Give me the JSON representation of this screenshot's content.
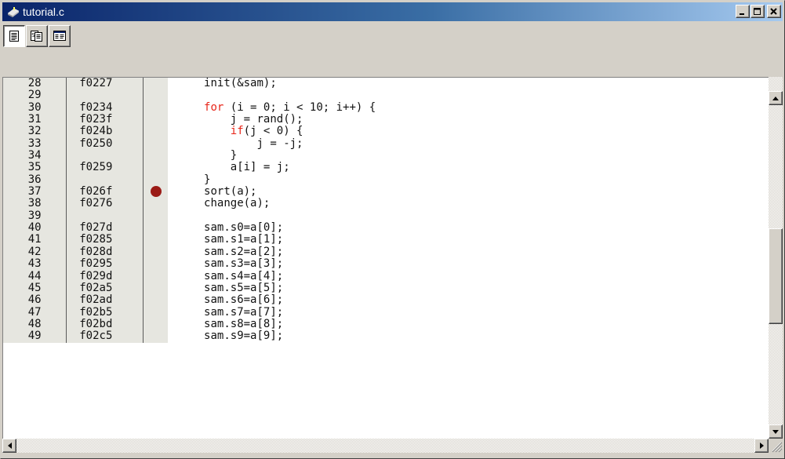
{
  "window": {
    "title": "tutorial.c",
    "title_icon": "application-icon",
    "controls": [
      "minimize-icon",
      "maximize-icon",
      "close-icon"
    ]
  },
  "toolbar": {
    "buttons": [
      {
        "icon": "source-view-icon",
        "pressed": true
      },
      {
        "icon": "mixed-view-icon",
        "pressed": false
      },
      {
        "icon": "disassembly-view-icon",
        "pressed": false
      }
    ]
  },
  "colors": {
    "keyword": "#e8261a",
    "breakpoint": "#9b1b16",
    "gutter": "#e6e6e0",
    "title_gradient_start": "#0a246a",
    "title_gradient_end": "#a6caf0"
  },
  "code": {
    "lines": [
      {
        "line": "28",
        "address": "f0227",
        "text": "init(&sam);",
        "indent": 0
      },
      {
        "line": "29",
        "address": "",
        "text": "",
        "indent": 0
      },
      {
        "line": "30",
        "address": "f0234",
        "kw": "for",
        "text": " (i = 0; i < 10; i++) {",
        "indent": 0
      },
      {
        "line": "31",
        "address": "f023f",
        "text": "j = rand();",
        "indent": 4
      },
      {
        "line": "32",
        "address": "f024b",
        "kw": "if",
        "text": "(j < 0) {",
        "indent": 4
      },
      {
        "line": "33",
        "address": "f0250",
        "text": "j = -j;",
        "indent": 8
      },
      {
        "line": "34",
        "address": "",
        "text": "}",
        "indent": 4
      },
      {
        "line": "35",
        "address": "f0259",
        "text": "a[i] = j;",
        "indent": 4
      },
      {
        "line": "36",
        "address": "",
        "text": "}",
        "indent": 0
      },
      {
        "line": "37",
        "address": "f026f",
        "text": "sort(a);",
        "indent": 0,
        "breakpoint": true
      },
      {
        "line": "38",
        "address": "f0276",
        "text": "change(a);",
        "indent": 0
      },
      {
        "line": "39",
        "address": "",
        "text": "",
        "indent": 0
      },
      {
        "line": "40",
        "address": "f027d",
        "text": "sam.s0=a[0];",
        "indent": 0
      },
      {
        "line": "41",
        "address": "f0285",
        "text": "sam.s1=a[1];",
        "indent": 0
      },
      {
        "line": "42",
        "address": "f028d",
        "text": "sam.s2=a[2];",
        "indent": 0
      },
      {
        "line": "43",
        "address": "f0295",
        "text": "sam.s3=a[3];",
        "indent": 0
      },
      {
        "line": "44",
        "address": "f029d",
        "text": "sam.s4=a[4];",
        "indent": 0
      },
      {
        "line": "45",
        "address": "f02a5",
        "text": "sam.s5=a[5];",
        "indent": 0
      },
      {
        "line": "46",
        "address": "f02ad",
        "text": "sam.s6=a[6];",
        "indent": 0
      },
      {
        "line": "47",
        "address": "f02b5",
        "text": "sam.s7=a[7];",
        "indent": 0
      },
      {
        "line": "48",
        "address": "f02bd",
        "text": "sam.s8=a[8];",
        "indent": 0
      },
      {
        "line": "49",
        "address": "f02c5",
        "text": "sam.s9=a[9];",
        "indent": 0
      }
    ]
  },
  "scrollbars": {
    "vertical": {
      "position_fraction": 0.55,
      "visible_fraction": 0.3
    },
    "horizontal": {
      "position_fraction": 0.0,
      "visible_fraction": 0.0
    }
  }
}
